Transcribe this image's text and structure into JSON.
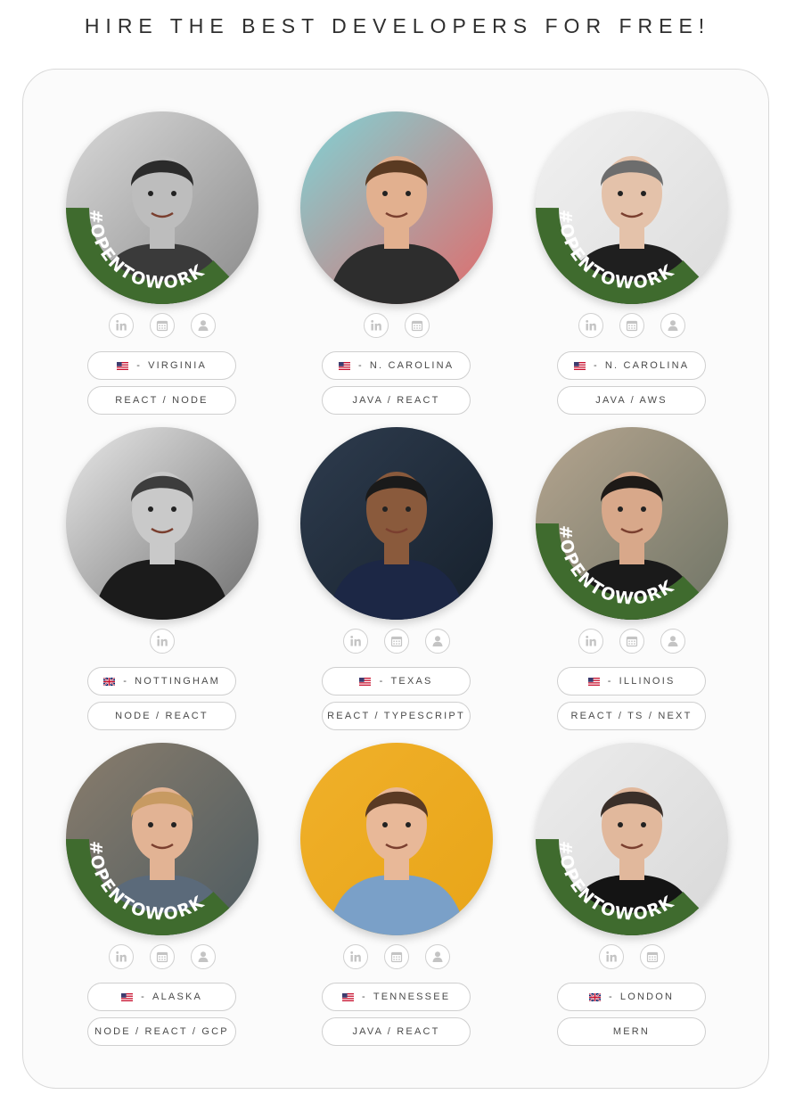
{
  "page": {
    "title": "HIRE THE BEST DEVELOPERS FOR FREE!"
  },
  "colors": {
    "opentowork_green": "#3f6b2e",
    "pill_border": "#cfcfcf",
    "icon_gray": "#c4c4c4"
  },
  "developers": [
    {
      "location": "VIRGINIA",
      "flag": "us",
      "stack": "REACT / NODE",
      "badge": "#OPENTOWORK",
      "icons": [
        "linkedin-icon",
        "calendar-icon",
        "profile-icon"
      ]
    },
    {
      "location": "N. CAROLINA",
      "flag": "us",
      "stack": "JAVA / REACT",
      "badge": "",
      "icons": [
        "linkedin-icon",
        "calendar-icon"
      ]
    },
    {
      "location": "N. CAROLINA",
      "flag": "us",
      "stack": "JAVA / AWS",
      "badge": "#OPENTOWORK",
      "icons": [
        "linkedin-icon",
        "calendar-icon",
        "profile-icon"
      ]
    },
    {
      "location": "NOTTINGHAM",
      "flag": "uk",
      "stack": "NODE / REACT",
      "badge": "",
      "icons": [
        "linkedin-icon"
      ]
    },
    {
      "location": "TEXAS",
      "flag": "us",
      "stack": "REACT / TYPESCRIPT",
      "badge": "",
      "icons": [
        "linkedin-icon",
        "calendar-icon",
        "profile-icon"
      ]
    },
    {
      "location": "ILLINOIS",
      "flag": "us",
      "stack": "REACT / TS / NEXT",
      "badge": "#OPENTOWORK",
      "icons": [
        "linkedin-icon",
        "calendar-icon",
        "profile-icon"
      ]
    },
    {
      "location": "ALASKA",
      "flag": "us",
      "stack": "NODE / REACT / GCP",
      "badge": "#OPENTOWORK",
      "icons": [
        "linkedin-icon",
        "calendar-icon",
        "profile-icon"
      ]
    },
    {
      "location": "TENNESSEE",
      "flag": "us",
      "stack": "JAVA / REACT",
      "badge": "",
      "icons": [
        "linkedin-icon",
        "calendar-icon",
        "profile-icon"
      ]
    },
    {
      "location": "LONDON",
      "flag": "uk",
      "stack": "MERN",
      "badge": "#OPENTOWORK",
      "icons": [
        "linkedin-icon",
        "calendar-icon"
      ]
    }
  ]
}
